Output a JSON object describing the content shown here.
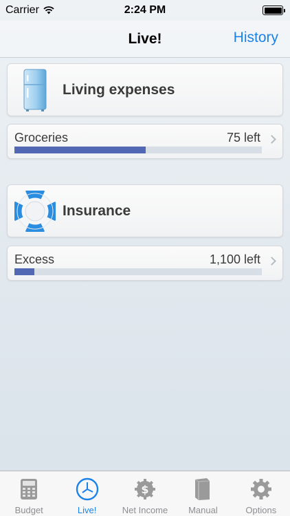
{
  "status_bar": {
    "carrier": "Carrier",
    "time": "2:24 PM"
  },
  "nav": {
    "title": "Live!",
    "history_label": "History"
  },
  "categories": [
    {
      "title": "Living expenses",
      "icon": "fridge-icon",
      "items": [
        {
          "name": "Groceries",
          "remaining": "75 left",
          "progress": 0.53
        }
      ]
    },
    {
      "title": "Insurance",
      "icon": "lifebuoy-icon",
      "items": [
        {
          "name": "Excess",
          "remaining": "1,100 left",
          "progress": 0.08
        }
      ]
    }
  ],
  "tabs": [
    {
      "label": "Budget",
      "icon": "calculator-icon",
      "active": false
    },
    {
      "label": "Live!",
      "icon": "clock-icon",
      "active": true
    },
    {
      "label": "Net Income",
      "icon": "dollar-gear-icon",
      "active": false
    },
    {
      "label": "Manual",
      "icon": "book-icon",
      "active": false
    },
    {
      "label": "Options",
      "icon": "gear-icon",
      "active": false
    }
  ],
  "colors": {
    "accent": "#1a82e8",
    "progress_fill": "#5268b5",
    "progress_track": "#d7dee5",
    "tab_inactive": "#8e8e93"
  }
}
